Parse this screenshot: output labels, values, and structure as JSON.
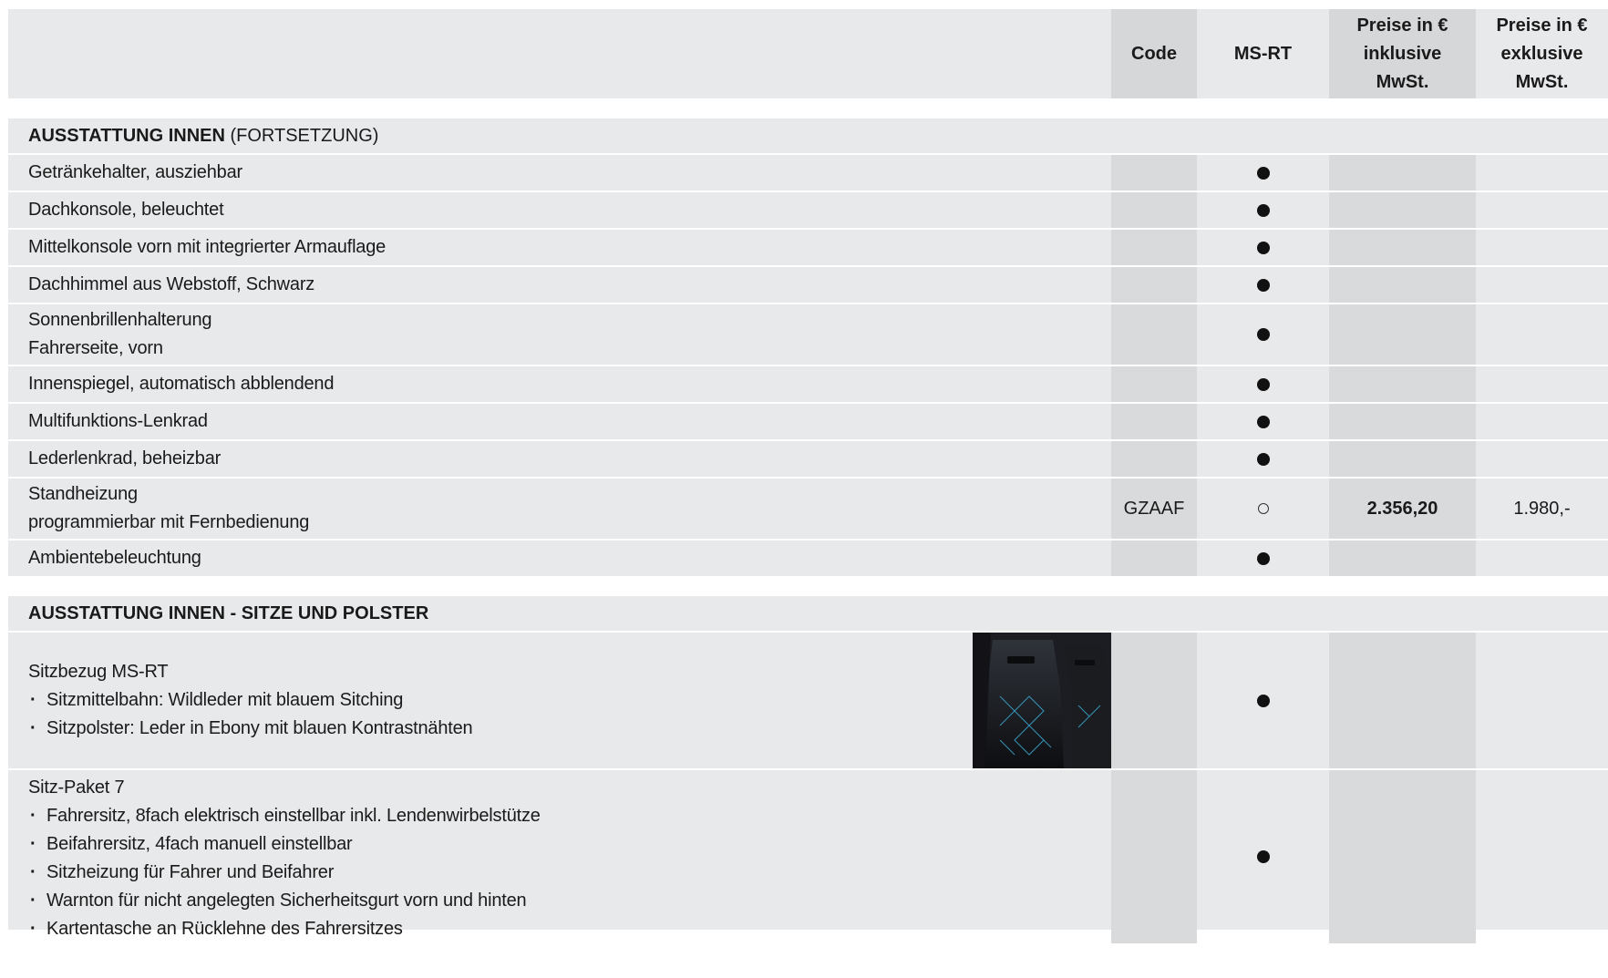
{
  "header": {
    "code": "Code",
    "ms_rt": "MS-RT",
    "incl_line1": "Preise in €",
    "incl_line2": "inklusive",
    "incl_line3": "MwSt.",
    "excl_line1": "Preise in €",
    "excl_line2": "exklusive",
    "excl_line3": "MwSt."
  },
  "section1": {
    "title_bold": "AUSSTATTUNG INNEN",
    "title_rest": " (FORTSETZUNG)",
    "rows": [
      {
        "line1": "Getränkehalter, ausziehbar"
      },
      {
        "line1": "Dachkonsole, beleuchtet"
      },
      {
        "line1": "Mittelkonsole vorn mit integrierter Armauflage"
      },
      {
        "line1": "Dachhimmel aus Webstoff, Schwarz"
      },
      {
        "line1": "Sonnenbrillenhalterung",
        "line2": "Fahrerseite, vorn"
      },
      {
        "line1": "Innenspiegel, automatisch abblendend"
      },
      {
        "line1": "Multifunktions-Lenkrad"
      },
      {
        "line1": "Lederlenkrad, beheizbar"
      },
      {
        "line1": "Standheizung",
        "line2": "programmierbar mit Fernbedienung",
        "code": "GZAAF",
        "incl": "2.356,20",
        "excl": "1.980,-"
      },
      {
        "line1": "Ambientebeleuchtung"
      }
    ]
  },
  "section2": {
    "title_bold": "AUSSTATTUNG INNEN - SITZE UND POLSTER",
    "rows": [
      {
        "title": "Sitzbezug MS-RT",
        "bullets": [
          "Sitzmittelbahn: Wildleder mit blauem Sitching",
          "Sitzpolster: Leder in Ebony mit blauen Kontrastnähten"
        ]
      },
      {
        "title": "Sitz-Paket 7",
        "bullets": [
          "Fahrersitz, 8fach elektrisch einstellbar inkl. Lendenwirbelstütze",
          "Beifahrersitz, 4fach manuell einstellbar",
          "Sitzheizung für Fahrer und Beifahrer",
          "Warnton für nicht angelegten Sicherheitsgurt vorn und hinten",
          "Kartentasche an Rücklehne des Fahrersitzes"
        ]
      }
    ]
  },
  "symbols": {
    "standard": "filled-dot-icon",
    "optional": "ring-icon"
  }
}
